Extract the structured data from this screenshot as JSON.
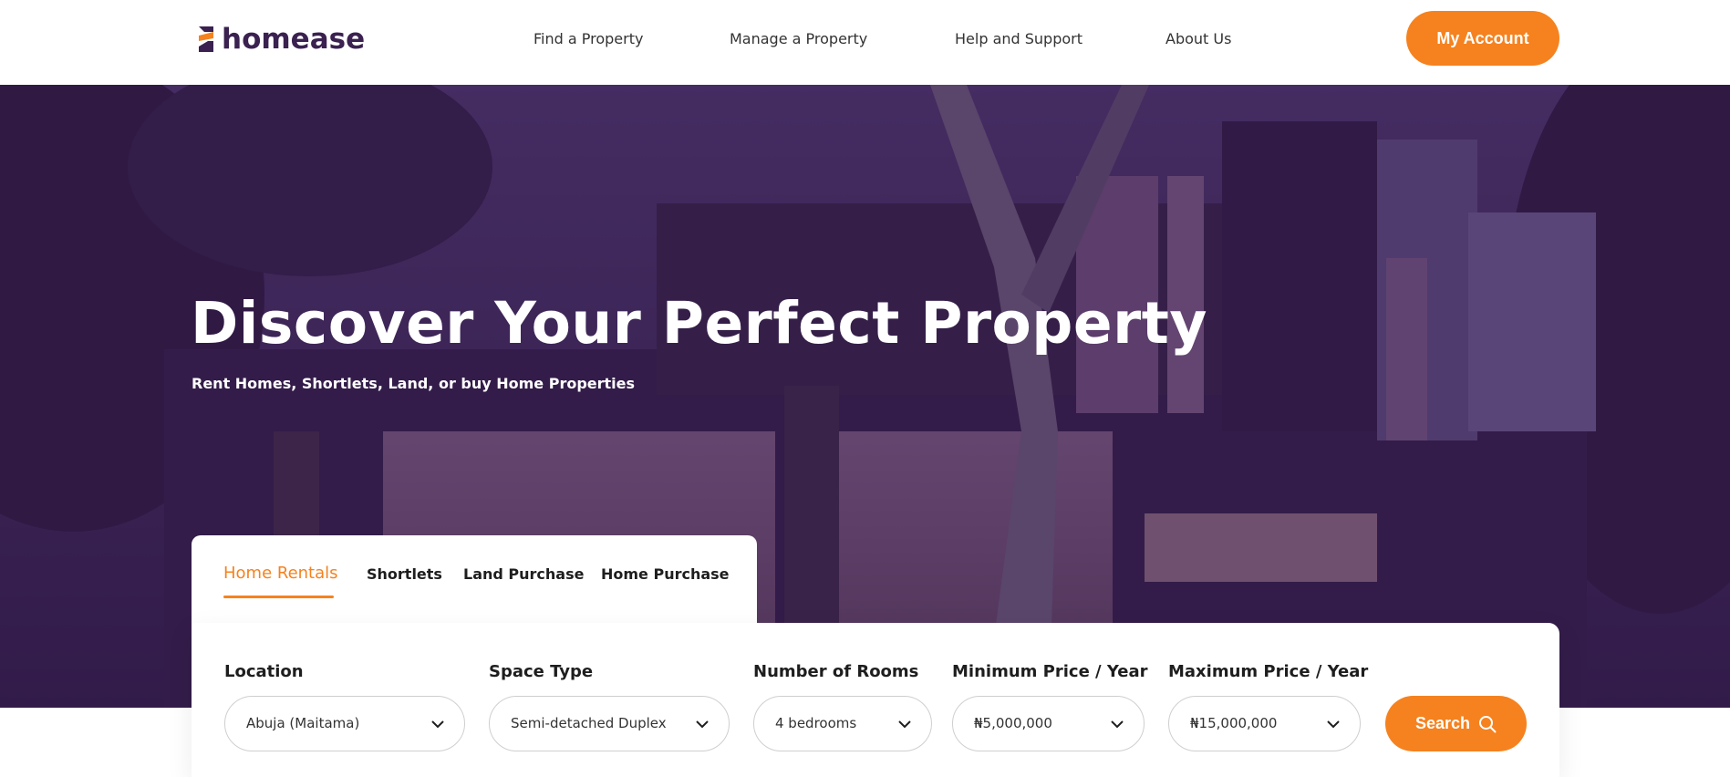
{
  "header": {
    "logo_text": "homease",
    "nav": [
      {
        "label": "Find a Property"
      },
      {
        "label": "Manage a Property"
      },
      {
        "label": "Help and Support"
      },
      {
        "label": "About Us"
      }
    ],
    "account_button": "My Account"
  },
  "hero": {
    "title": "Discover Your Perfect Property",
    "subtitle": "Rent Homes, Shortlets, Land, or buy Home Properties"
  },
  "tabs": [
    {
      "label": "Home Rentals",
      "active": true
    },
    {
      "label": "Shortlets",
      "active": false
    },
    {
      "label": "Land Purchase",
      "active": false
    },
    {
      "label": "Home Purchase",
      "active": false
    }
  ],
  "search": {
    "fields": [
      {
        "label": "Location",
        "value": "Abuja (Maitama)"
      },
      {
        "label": "Space Type",
        "value": "Semi-detached Duplex"
      },
      {
        "label": "Number of Rooms",
        "value": "4 bedrooms"
      },
      {
        "label": "Minimum Price / Year",
        "value": "₦5,000,000"
      },
      {
        "label": "Maximum Price / Year",
        "value": "₦15,000,000"
      }
    ],
    "button": "Search"
  },
  "colors": {
    "accent": "#f5821f",
    "brand": "#3a2150",
    "hero_overlay": "#3b2452"
  },
  "icons": [
    "logo-icon",
    "chevron-down-icon",
    "search-icon"
  ]
}
